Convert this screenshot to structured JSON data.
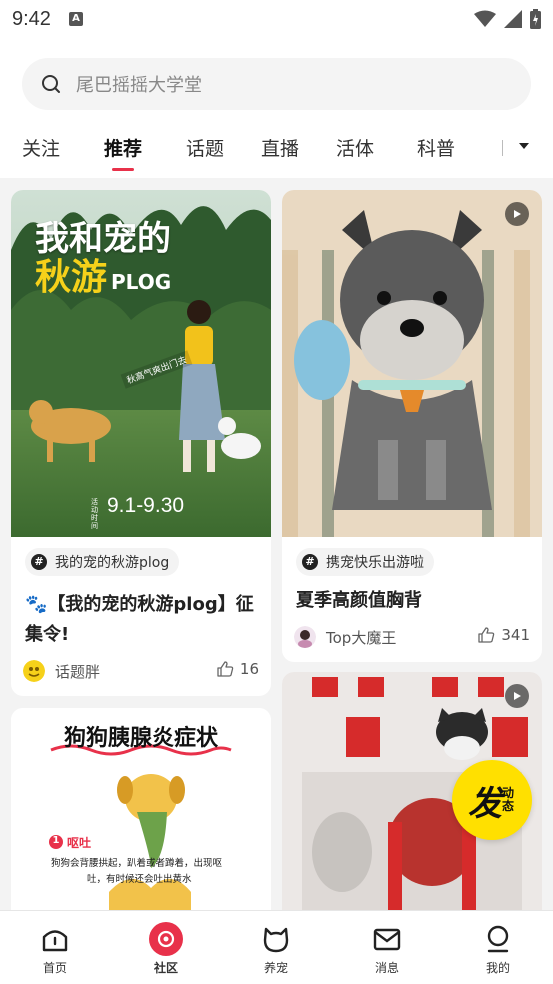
{
  "status": {
    "time": "9:42"
  },
  "search": {
    "placeholder": "尾巴摇摇大学堂"
  },
  "tabs": [
    "关注",
    "推荐",
    "话题",
    "直播",
    "活体",
    "科普"
  ],
  "posts": [
    {
      "poster_title_1": "我和宠的",
      "poster_title_2": "秋游",
      "poster_plog": "PLOG",
      "poster_tag": "秋高气爽出门去",
      "poster_date_label": "活动\n时间",
      "poster_date": "9.1-9.30",
      "topic": "我的宠的秋游plog",
      "title": "【我的宠的秋游plog】征集令!",
      "author": "话题胖",
      "likes": "16"
    },
    {
      "topic": "携宠快乐出游啦",
      "title": "夏季高颜值胸背",
      "author": "Top大魔王",
      "likes": "341"
    },
    {
      "poster_heading": "狗狗胰腺炎症状",
      "poster_step_no": "1",
      "poster_step_label": "呕吐",
      "poster_text_1": "狗狗会背腰拱起，趴着或者蹲着，出现呕",
      "poster_text_2": "吐，有时候还会吐出黄水"
    },
    {}
  ],
  "fab": {
    "big": "发",
    "small": "动态"
  },
  "nav": [
    "首页",
    "社区",
    "养宠",
    "消息",
    "我的"
  ],
  "colors": {
    "accent": "#e8314a",
    "fab": "#ffe000"
  }
}
